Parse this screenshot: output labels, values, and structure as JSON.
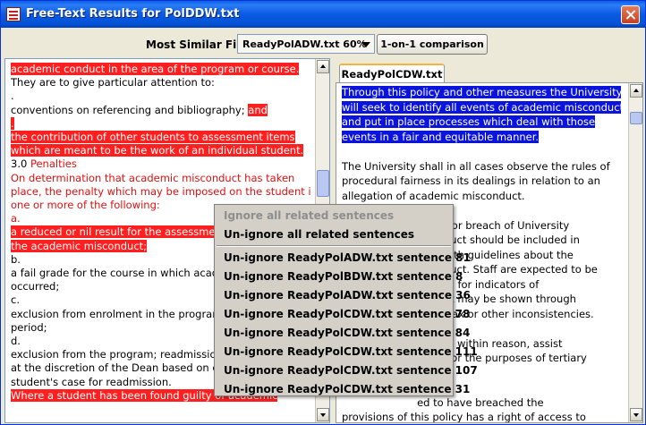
{
  "window": {
    "title": "Free-Text Results for PolDDW.txt"
  },
  "toolbar": {
    "label": "Most Similar Files:",
    "combo_value": "ReadyPolADW.txt 60%",
    "compare_button": "1-on-1 comparison"
  },
  "left_pane": {
    "lines": [
      {
        "text": "academic conduct in the area of the program or course.",
        "style": "hl"
      },
      {
        "text": "They are to give particular attention to:",
        "style": ""
      },
      {
        "text": ".",
        "style": ""
      },
      {
        "text": "conventions on referencing and bibliography;",
        "style": "",
        "tail": "and",
        "tail_style": "hl"
      },
      {
        "text": ".",
        "style": "hl-short"
      },
      {
        "text": "the contribution of other students to assessment items",
        "style": "hl"
      },
      {
        "text": "which are meant to be the work of an individual student.",
        "style": "hl"
      },
      {
        "text": "3.0",
        "style": "",
        "tail": "Penalties",
        "tail_style": "red"
      },
      {
        "text": "On determination that academic misconduct has taken",
        "style": "red"
      },
      {
        "text": "place, the penalty which may be imposed on the student is",
        "style": "red"
      },
      {
        "text": "one or more of the following:",
        "style": "red"
      },
      {
        "text": "a.",
        "style": "red"
      },
      {
        "text": "a reduced or nil result for the assessment",
        "style": "hl"
      },
      {
        "text": "the academic misconduct;",
        "style": "hl"
      },
      {
        "text": "b.",
        "style": ""
      },
      {
        "text": "a fail grade for the course in which acader",
        "style": ""
      },
      {
        "text": "occurred;",
        "style": ""
      },
      {
        "text": "c.",
        "style": ""
      },
      {
        "text": "exclusion from enrolment in the program f",
        "style": ""
      },
      {
        "text": "period;",
        "style": ""
      },
      {
        "text": "d.",
        "style": ""
      },
      {
        "text": "exclusion from the program; readmission",
        "style": ""
      },
      {
        "text": "at the discretion of the Dean based on cor",
        "style": ""
      },
      {
        "text": "student's case for readmission.",
        "style": ""
      },
      {
        "text": "Where a student has been found guilty of academic",
        "style": "hl"
      }
    ]
  },
  "right_tab": {
    "label": "ReadyPolCDW.txt"
  },
  "right_pane": {
    "lines": [
      {
        "text": "Through this policy and other measures the University",
        "style": "hl"
      },
      {
        "text": "will seek to identify all events of academic misconduct",
        "style": "hl"
      },
      {
        "text": "and put in place processes which deal with those",
        "style": "hl"
      },
      {
        "text": "events in a fair and equitable manner.",
        "style": "hl"
      },
      {
        "text": "",
        "style": ""
      },
      {
        "text": "The University shall in all cases observe the rules of",
        "style": ""
      },
      {
        "text": "procedural fairness in its dealings in relation to an",
        "style": ""
      },
      {
        "text": "allegation of academic misconduct.",
        "style": ""
      },
      {
        "text": "",
        "style": ""
      },
      {
        "text": "                       alties for breach of University",
        "style": ""
      },
      {
        "text": "                       isconduct should be included in",
        "style": ""
      },
      {
        "text": "                       long with guidelines about the",
        "style": ""
      },
      {
        "text": "                       isconduct. Staff are expected to be",
        "style": ""
      },
      {
        "text": "                       looking for indicators of",
        "style": ""
      },
      {
        "text": "                       ng that may be shown through",
        "style": ""
      },
      {
        "text": "                       e, syntax or other inconsistencies.",
        "style": ""
      },
      {
        "text": "",
        "style": ""
      },
      {
        "text": "                       aff will, within reason, assist",
        "style": ""
      },
      {
        "text": "                       erate for the purposes of tertiary",
        "style": ""
      },
      {
        "text": "",
        "style": ""
      },
      {
        "text": "",
        "style": ""
      },
      {
        "text": "                       ed to have breached the",
        "style": ""
      },
      {
        "text": "provisions of this policy has a right of access to",
        "style": ""
      }
    ]
  },
  "context_menu": {
    "items": [
      {
        "label": "Ignore all related sentences",
        "disabled": true
      },
      {
        "label": "Un-ignore all related sentences",
        "disabled": false
      },
      {
        "label": "Un-ignore ReadyPolADW.txt sentence 81",
        "disabled": false
      },
      {
        "label": "Un-ignore ReadyPolBDW.txt sentence 8",
        "disabled": false
      },
      {
        "label": "Un-ignore ReadyPolADW.txt sentence 36",
        "disabled": false
      },
      {
        "label": "Un-ignore ReadyPolCDW.txt sentence 78",
        "disabled": false
      },
      {
        "label": "Un-ignore ReadyPolCDW.txt sentence 84",
        "disabled": false
      },
      {
        "label": "Un-ignore ReadyPolCDW.txt sentence 111",
        "disabled": false
      },
      {
        "label": "Un-ignore ReadyPolCDW.txt sentence 107",
        "disabled": false
      },
      {
        "label": "Un-ignore ReadyPolCDW.txt sentence 31",
        "disabled": false
      }
    ]
  },
  "colors": {
    "highlight_red": "#ff1f1f",
    "highlight_blue": "#0a14dc",
    "red_text": "#e01010"
  }
}
